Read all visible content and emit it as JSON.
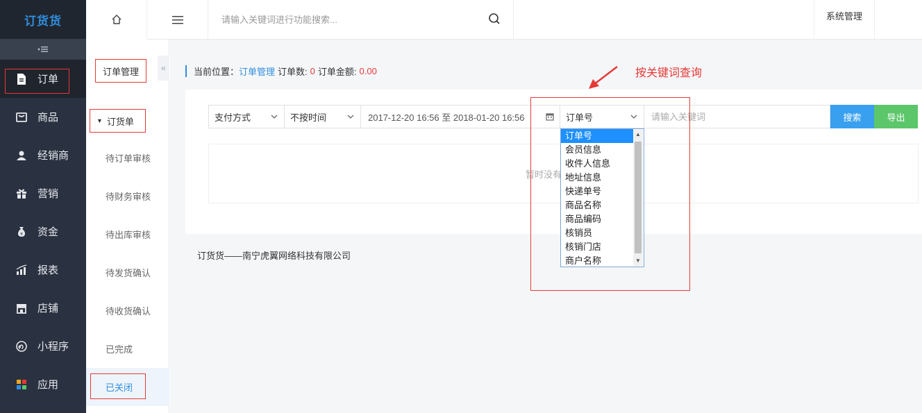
{
  "app": {
    "logo": "订货货"
  },
  "sidebar": {
    "items": [
      {
        "label": "订单",
        "icon": "document-icon"
      },
      {
        "label": "商品",
        "icon": "box-icon"
      },
      {
        "label": "经销商",
        "icon": "user-icon"
      },
      {
        "label": "营销",
        "icon": "gift-icon"
      },
      {
        "label": "资金",
        "icon": "money-bag-icon"
      },
      {
        "label": "报表",
        "icon": "chart-icon"
      },
      {
        "label": "店铺",
        "icon": "store-icon"
      },
      {
        "label": "小程序",
        "icon": "miniprogram-icon"
      },
      {
        "label": "应用",
        "icon": "apps-icon"
      }
    ]
  },
  "subnav": {
    "title": "订单管理",
    "group": "订货单",
    "items": [
      "待订单审核",
      "待财务审核",
      "待出库审核",
      "待发货确认",
      "待收货确认",
      "已完成",
      "已关闭"
    ]
  },
  "topbar": {
    "search_placeholder": "请输入关键词进行功能搜索...",
    "system_management": "系统管理"
  },
  "breadcrumb": {
    "prefix": "当前位置：",
    "link": "订单管理",
    "order_count_label": "订单数:",
    "order_count": "0",
    "order_amount_label": "订单金额:",
    "order_amount": "0.00"
  },
  "filters": {
    "payment": "支付方式",
    "time": "不按时间",
    "date_range": "2017-12-20 16:56 至 2018-01-20 16:56",
    "keyword_field": "订单号",
    "keyword_placeholder": "请输入关键词",
    "search_btn": "搜索",
    "export_btn": "导出"
  },
  "dropdown": {
    "options": [
      "订单号",
      "会员信息",
      "收件人信息",
      "地址信息",
      "快递单号",
      "商品名称",
      "商品编码",
      "核销员",
      "核销门店",
      "商户名称"
    ]
  },
  "table": {
    "empty_text": "暂时没有"
  },
  "footer": {
    "text": "订货货——南宁虎翼网络科技有限公司"
  },
  "annotation": {
    "text": "按关键词查询"
  },
  "colors": {
    "accent": "#2f8ee0",
    "annotation": "#e53935",
    "sidebar_bg": "#2a3140",
    "search_btn": "#39a0ef",
    "export_btn": "#5cc66b"
  }
}
